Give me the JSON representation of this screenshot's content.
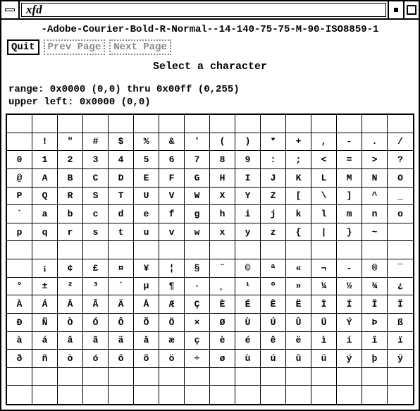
{
  "window": {
    "title": "xfd"
  },
  "font_name": "-Adobe-Courier-Bold-R-Normal--14-140-75-75-M-90-ISO8859-1",
  "buttons": {
    "quit": "Quit",
    "prev": "Prev Page",
    "next": "Next Page"
  },
  "prompt": "Select a character",
  "range_line": "range:  0x0000 (0,0) thru 0x00ff (0,255)",
  "upper_left_line": "upper left:  0x0000 (0,0)",
  "grid": {
    "cols": 16,
    "rows": 16,
    "chars": [
      [
        "",
        "",
        "",
        "",
        "",
        "",
        "",
        "",
        "",
        "",
        "",
        "",
        "",
        "",
        "",
        ""
      ],
      [
        "",
        "!",
        "\"",
        "#",
        "$",
        "%",
        "&",
        "'",
        "(",
        ")",
        "*",
        "+",
        ",",
        "-",
        ".",
        "/"
      ],
      [
        "0",
        "1",
        "2",
        "3",
        "4",
        "5",
        "6",
        "7",
        "8",
        "9",
        ":",
        ";",
        "<",
        "=",
        ">",
        "?"
      ],
      [
        "@",
        "A",
        "B",
        "C",
        "D",
        "E",
        "F",
        "G",
        "H",
        "I",
        "J",
        "K",
        "L",
        "M",
        "N",
        "O"
      ],
      [
        "P",
        "Q",
        "R",
        "S",
        "T",
        "U",
        "V",
        "W",
        "X",
        "Y",
        "Z",
        "[",
        "\\",
        "]",
        "^",
        "_"
      ],
      [
        "`",
        "a",
        "b",
        "c",
        "d",
        "e",
        "f",
        "g",
        "h",
        "i",
        "j",
        "k",
        "l",
        "m",
        "n",
        "o"
      ],
      [
        "p",
        "q",
        "r",
        "s",
        "t",
        "u",
        "v",
        "w",
        "x",
        "y",
        "z",
        "{",
        "|",
        "}",
        "~",
        ""
      ],
      [
        "",
        "",
        "",
        "",
        "",
        "",
        "",
        "",
        "",
        "",
        "",
        "",
        "",
        "",
        "",
        ""
      ],
      [
        "",
        "¡",
        "¢",
        "£",
        "¤",
        "¥",
        "¦",
        "§",
        "¨",
        "©",
        "ª",
        "«",
        "¬",
        "­-",
        "®",
        "¯"
      ],
      [
        "°",
        "±",
        "²",
        "³",
        "´",
        "µ",
        "¶",
        "·",
        "¸",
        "¹",
        "º",
        "»",
        "¼",
        "½",
        "¾",
        "¿"
      ],
      [
        "À",
        "Á",
        "Â",
        "Ã",
        "Ä",
        "Å",
        "Æ",
        "Ç",
        "È",
        "É",
        "Ê",
        "Ë",
        "Ì",
        "Í",
        "Î",
        "Ï"
      ],
      [
        "Ð",
        "Ñ",
        "Ò",
        "Ó",
        "Ô",
        "Õ",
        "Ö",
        "×",
        "Ø",
        "Ù",
        "Ú",
        "Û",
        "Ü",
        "Ý",
        "Þ",
        "ß"
      ],
      [
        "à",
        "á",
        "â",
        "ã",
        "ä",
        "å",
        "æ",
        "ç",
        "è",
        "é",
        "ê",
        "ë",
        "ì",
        "í",
        "î",
        "ï"
      ],
      [
        "ð",
        "ñ",
        "ò",
        "ó",
        "ô",
        "õ",
        "ö",
        "÷",
        "ø",
        "ù",
        "ú",
        "û",
        "ü",
        "ý",
        "þ",
        "ÿ"
      ]
    ]
  }
}
